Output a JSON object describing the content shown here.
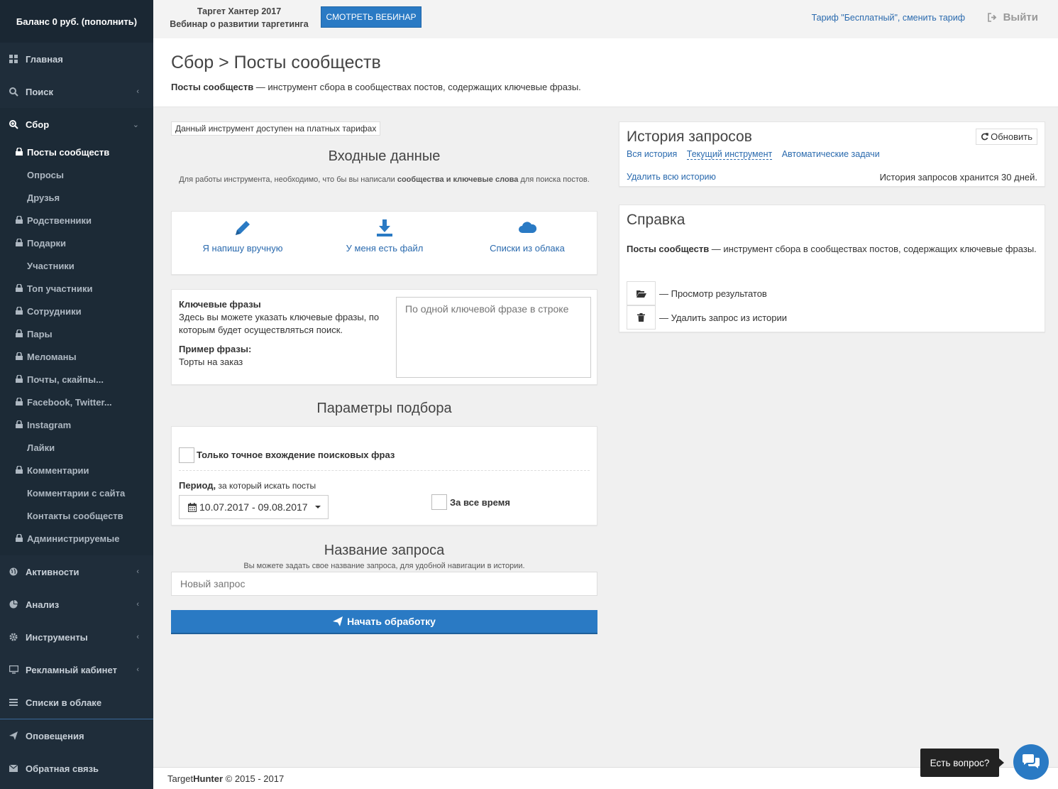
{
  "sidebar": {
    "balance": "Баланс 0 руб. (пополнить)",
    "items_top": [
      {
        "label": "Главная",
        "icon": "grid-icon"
      },
      {
        "label": "Поиск",
        "icon": "search-icon"
      },
      {
        "label": "Сбор",
        "icon": "zoom-in-icon"
      }
    ],
    "sub_items": [
      {
        "label": "Посты сообществ",
        "locked": true,
        "current": true
      },
      {
        "label": "Опросы",
        "locked": false
      },
      {
        "label": "Друзья",
        "locked": false
      },
      {
        "label": "Родственники",
        "locked": true
      },
      {
        "label": "Подарки",
        "locked": true
      },
      {
        "label": "Участники",
        "locked": false
      },
      {
        "label": "Топ участники",
        "locked": true
      },
      {
        "label": "Сотрудники",
        "locked": true
      },
      {
        "label": "Пары",
        "locked": true
      },
      {
        "label": "Меломаны",
        "locked": true
      },
      {
        "label": "Почты, скайпы...",
        "locked": true
      },
      {
        "label": "Facebook, Twitter...",
        "locked": true
      },
      {
        "label": "Instagram",
        "locked": true
      },
      {
        "label": "Лайки",
        "locked": false
      },
      {
        "label": "Комментарии",
        "locked": true
      },
      {
        "label": "Комментарии с сайта",
        "locked": false
      },
      {
        "label": "Контакты сообществ",
        "locked": false
      },
      {
        "label": "Администрируемые",
        "locked": true
      }
    ],
    "items_bottom": [
      {
        "label": "Активности",
        "icon": "globe-icon"
      },
      {
        "label": "Анализ",
        "icon": "pie-chart-icon"
      },
      {
        "label": "Инструменты",
        "icon": "gear-icon"
      },
      {
        "label": "Рекламный кабинет",
        "icon": "monitor-icon"
      },
      {
        "label": "Списки в облаке",
        "icon": "list-icon"
      }
    ],
    "items_footer": [
      {
        "label": "Оповещения",
        "icon": "paper-plane-icon"
      },
      {
        "label": "Обратная связь",
        "icon": "envelope-icon"
      }
    ]
  },
  "topbar": {
    "promo_line1": "Таргет Хантер 2017",
    "promo_line2": "Вебинар о развитии таргетинга",
    "webinar_button": "СМОТРЕТЬ ВЕБИНАР",
    "tariff_link": "Тариф \"Бесплатный\", сменить тариф",
    "exit": "Выйти"
  },
  "page": {
    "title": "Сбор > Посты сообществ",
    "desc_bold": "Посты сообществ",
    "desc_rest": " — инструмент сбора в сообществах постов, содержащих ключевые фразы."
  },
  "input": {
    "notice": "Данный инструмент доступен на платных тарифах",
    "title": "Входные данные",
    "sub_part1": "Для работы инструмента, необходимо, что бы вы написали ",
    "sub_bold": "сообщества и ключевые слова",
    "sub_part2": " для поиска постов.",
    "choices": [
      {
        "label": "Я напишу вручную",
        "icon": "pencil-icon"
      },
      {
        "label": "У меня есть файл",
        "icon": "download-icon"
      },
      {
        "label": "Списки из облака",
        "icon": "cloud-icon"
      }
    ]
  },
  "keywords": {
    "title": "Ключевые фразы",
    "desc": "Здесь вы можете указать ключевые фразы, по которым будет осуществляться поиск.",
    "example_title": "Пример фразы:",
    "example": "Торты на заказ",
    "placeholder": "По одной ключевой фразе в строке"
  },
  "params": {
    "title": "Параметры подбора",
    "exact_label": "Только точное вхождение поисковых фраз",
    "period_bold": "Период,",
    "period_rest": " за который искать посты",
    "date_range": "10.07.2017 - 09.08.2017",
    "all_time_label": "За все время"
  },
  "request_name": {
    "title": "Название запроса",
    "sub": "Вы можете задать свое название запроса, для удобной навигации в истории.",
    "placeholder": "Новый запрос",
    "start_button": "Начать обработку"
  },
  "history": {
    "title": "История запросов",
    "refresh": "Обновить",
    "links": [
      "Вся история",
      "Текущий инструмент",
      "Автоматические задачи"
    ],
    "delete_all": "Удалить всю историю",
    "keep_note": "История запросов хранится 30 дней."
  },
  "help": {
    "title": "Справка",
    "text_bold": "Посты сообществ",
    "text_rest": " — инструмент сбора в сообществах постов, содержащих ключевые фразы.",
    "view_results": "— Просмотр результатов",
    "delete_request": "— Удалить запрос из истории"
  },
  "footer": {
    "brand_plain": "Target",
    "brand_bold": "Hunter",
    "copyright": " © 2015 - 2017"
  },
  "chat": {
    "bubble": "Есть вопрос?"
  },
  "colors": {
    "sidebar_bg": "#1f2d3a",
    "accent": "#2a7ac4",
    "link": "#2a6aae"
  }
}
